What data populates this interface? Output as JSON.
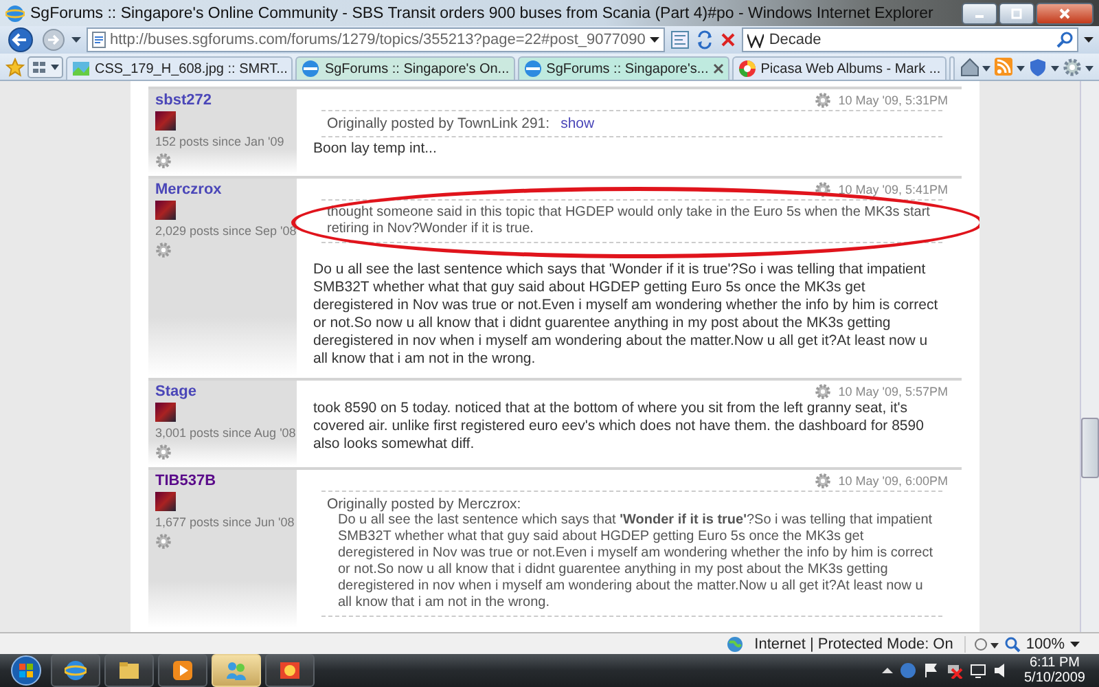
{
  "window": {
    "title": "SgForums :: Singapore's Online Community - SBS Transit orders 900 buses from Scania (Part 4)#po - Windows Internet Explorer"
  },
  "address_bar": {
    "url": "http://buses.sgforums.com/forums/1279/topics/355213?page=22#post_9077090"
  },
  "search_box": {
    "value": "Decade"
  },
  "tabs": [
    {
      "label": "CSS_179_H_608.jpg :: SMRT...",
      "selected": false
    },
    {
      "label": "SgForums :: Singapore's On...",
      "selected": false
    },
    {
      "label": "SgForums :: Singapore's...",
      "selected": true
    },
    {
      "label": "Picasa Web Albums - Mark ...",
      "selected": false
    }
  ],
  "posts": [
    {
      "author": "sbst272",
      "stats": "152 posts since Jan '09",
      "time": "10 May '09, 5:31PM",
      "circled": false,
      "quote": {
        "header": "Originally posted by TownLink 291:",
        "link": "show"
      },
      "body": "Boon lay temp int..."
    },
    {
      "author": "Merczrox",
      "stats": "2,029 posts since Sep '08",
      "time": "10 May '09, 5:41PM",
      "circled": true,
      "quote": {
        "text": "thought someone said in this topic that HGDEP would only take in the Euro 5s when the MK3s start retiring in Nov?Wonder if it is true."
      },
      "body": "Do u all see the last sentence which says that 'Wonder if it is true'?So i was telling that impatient SMB32T whether what that guy said about HGDEP getting Euro 5s once the MK3s get deregistered in Nov was true or not.Even i myself am wondering whether the info by him is correct or not.So now u all know that i didnt guarentee anything in my post about the MK3s getting deregistered in nov when i myself am wondering about the matter.Now u all get it?At least now u all know that i am not in the wrong."
    },
    {
      "author": "Stage",
      "stats": "3,001 posts since Aug '08",
      "time": "10 May '09, 5:57PM",
      "circled": false,
      "body": "took 8590 on 5 today. noticed that at the bottom of where you sit from the left granny seat, it's covered air. unlike first registered euro eev's which does not have them. the dashboard for 8590 also looks somewhat diff."
    },
    {
      "author": "TIB537B",
      "stats": "1,677 posts since Jun '08",
      "time": "10 May '09, 6:00PM",
      "circled": false,
      "quote": {
        "header": "Originally posted by Merczrox:",
        "text": "Do u all see the last sentence which says that **'Wonder if it is true'**?So i was telling that impatient SMB32T whether what that guy said about HGDEP getting Euro 5s once the MK3s get deregistered in Nov was true or not.Even i myself am wondering whether the info by him is correct or not.So now u all know that i didnt guarentee anything in my post about the MK3s getting deregistered in nov when i myself am wondering about the matter.Now u all get it?At least now u all know that i am not in the wrong."
      }
    }
  ],
  "status_bar": {
    "zone": "Internet | Protected Mode: On",
    "zoom": "100%"
  },
  "taskbar": {
    "apps": [
      {
        "active": false
      },
      {
        "active": false
      },
      {
        "active": false
      },
      {
        "active": true
      },
      {
        "active": false
      }
    ],
    "time": "6:11 PM",
    "date": "5/10/2009"
  }
}
